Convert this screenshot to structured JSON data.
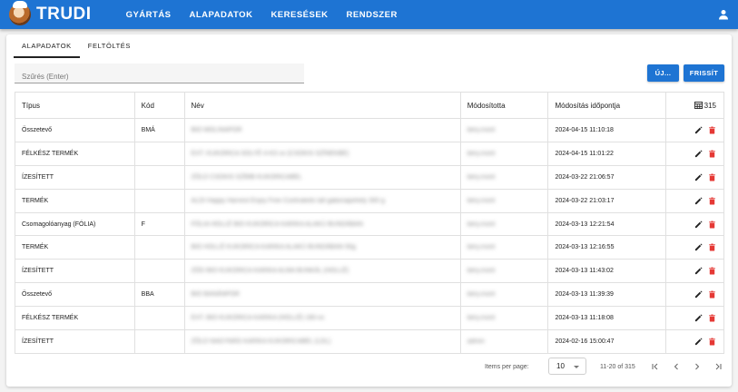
{
  "colors": {
    "brand": "#1e74d3",
    "edit": "#212121",
    "delete": "#e53935"
  },
  "app": {
    "title": "TRUDI"
  },
  "nav": [
    {
      "label": "GYÁRTÁS"
    },
    {
      "label": "ALAPADATOK"
    },
    {
      "label": "KERESÉSEK"
    },
    {
      "label": "RENDSZER"
    }
  ],
  "tabs": [
    {
      "label": "ALAPADATOK",
      "active": true
    },
    {
      "label": "FELTÖLTÉS",
      "active": false
    }
  ],
  "filter": {
    "placeholder": "Szűrés (Enter)",
    "value": ""
  },
  "buttons": {
    "new": "ÚJ...",
    "refresh": "FRISSÍT"
  },
  "table": {
    "headers": [
      "Típus",
      "Kód",
      "Név",
      "Módosította",
      "Módosítás időpontja"
    ],
    "total_count": "315",
    "rows": [
      {
        "tipus": "Összetevő",
        "kod": "BMÁ",
        "nev": "BIO MOLINAPOR",
        "modositotta": "béry.mont",
        "idopont": "2024-04-15 11:10:18"
      },
      {
        "tipus": "FÉLKÉSZ TERMÉK",
        "kod": "",
        "nev": "EXT. KUKORICA SOLYÉ 4-KS xx (CSOKIS SZÍNEKBE)",
        "modositotta": "béry.mont",
        "idopont": "2024-04-15 11:01:22"
      },
      {
        "tipus": "ÍZESÍTETT",
        "kod": "",
        "nev": "ZÖLD CSOKIS SZÍMB KUKORICABEL",
        "modositotta": "béry.mont",
        "idopont": "2024-03-22 21:06:57"
      },
      {
        "tipus": "TERMÉK",
        "kod": "",
        "nev": "ALDI Happy Harvest Enjoy Free Coshraleds tall gabonapehely 300 g",
        "modositotta": "béry.mont",
        "idopont": "2024-03-22 21:03:17"
      },
      {
        "tipus": "Csomagolóanyag (FÓLIA)",
        "kod": "F",
        "nev": "FÓLIA HOLLÉ BIO KUKORICA KARIKA ALAKÚ BUNDÁBAN",
        "modositotta": "béry.mont",
        "idopont": "2024-03-13 12:21:54"
      },
      {
        "tipus": "TERMÉK",
        "kod": "",
        "nev": "BIO HOLLÉ KUKORICA KARIKA ALAKÚ BUNDÁBAN 50g",
        "modositotta": "béry.mont",
        "idopont": "2024-03-13 12:16:55"
      },
      {
        "tipus": "ÍZESÍTETT",
        "kod": "",
        "nev": "ZÖD BIO KUKORICA KARIKA ALMA BUNKÁL (HOLLÉ)",
        "modositotta": "béry.mont",
        "idopont": "2024-03-13 11:43:02"
      },
      {
        "tipus": "Összetevő",
        "kod": "BBA",
        "nev": "BIO BANÁNPOR",
        "modositotta": "béry.mont",
        "idopont": "2024-03-13 11:39:39"
      },
      {
        "tipus": "FÉLKÉSZ TERMÉK",
        "kod": "",
        "nev": "EXT. BIO KUKORICA KARIKA (HOLLÉ) 180-xx",
        "modositotta": "béry.mont",
        "idopont": "2024-03-13 11:18:08"
      },
      {
        "tipus": "ÍZESÍTETT",
        "kod": "",
        "nev": "ZÖLD NAGYMÁS KARIKA KUKORICABEL (LDL)",
        "modositotta": "admin",
        "idopont": "2024-02-16 15:00:47"
      }
    ]
  },
  "paginator": {
    "items_per_page_label": "Items per page:",
    "page_size": "10",
    "range": "11-20 of 315"
  }
}
